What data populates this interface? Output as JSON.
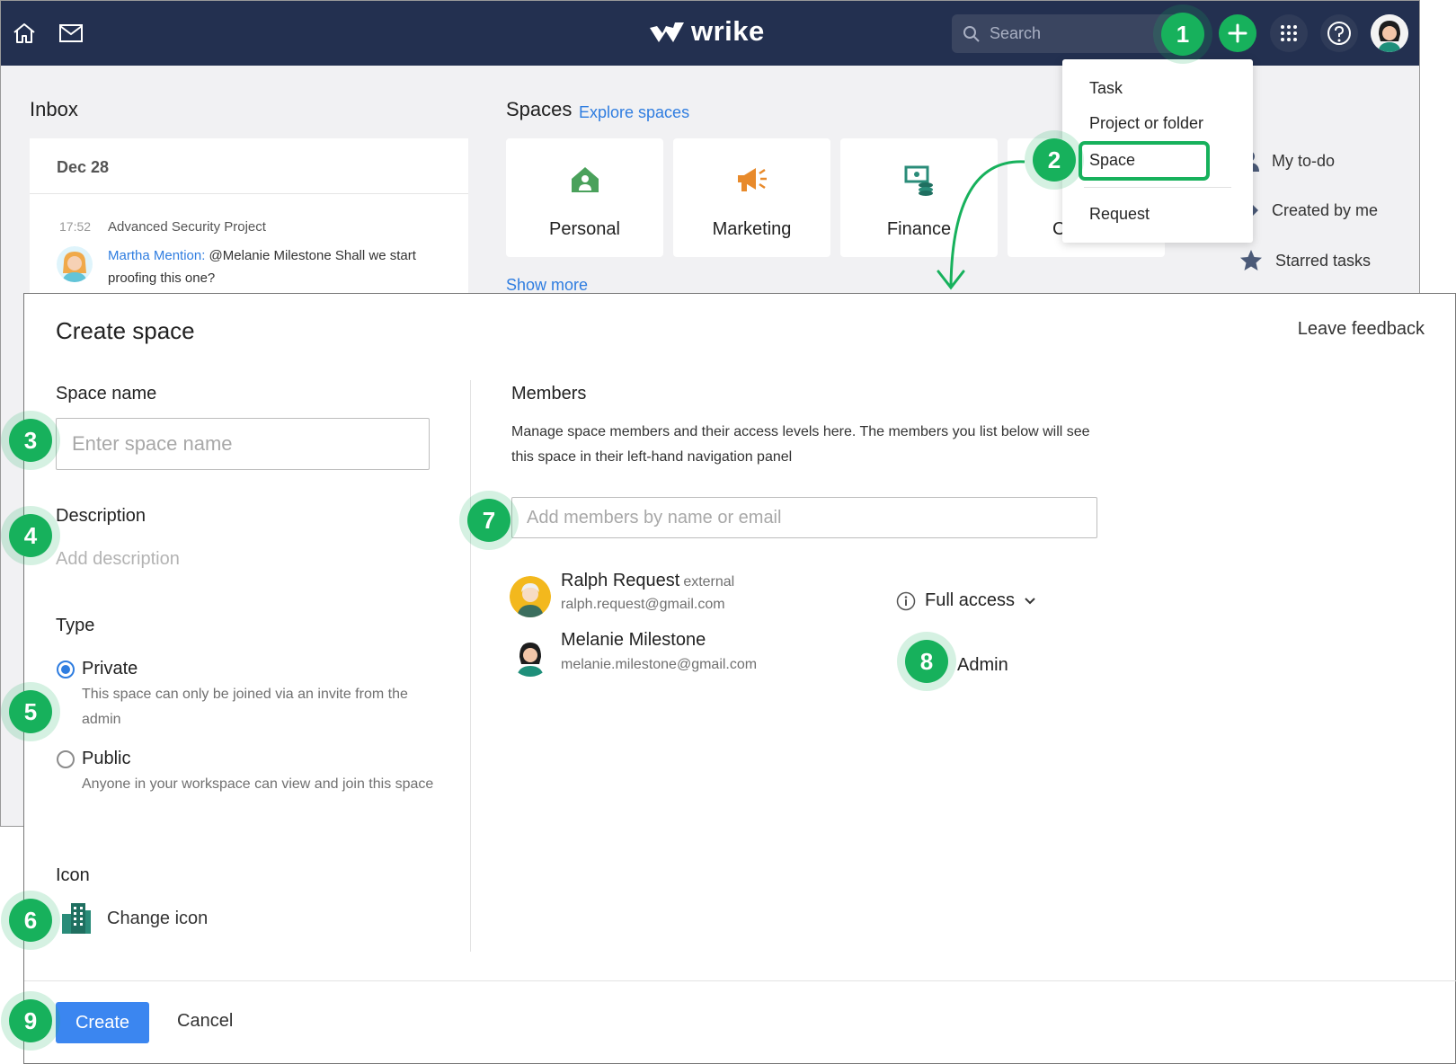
{
  "brand": {
    "name": "wrike",
    "accent": "#17b15c",
    "nav_bg": "#233050",
    "link": "#2f7de0",
    "primary_button": "#3b86f0"
  },
  "topbar": {
    "search_placeholder": "Search",
    "icons": [
      "home-icon",
      "mail-icon",
      "search-icon",
      "plus-icon",
      "apps-grid-icon",
      "help-icon"
    ]
  },
  "inbox": {
    "title": "Inbox",
    "date": "Dec 28",
    "notification": {
      "time": "17:52",
      "project": "Advanced Security Project",
      "author": "Martha Mention:",
      "message": " @Melanie Milestone Shall we start proofing this one?"
    }
  },
  "spaces": {
    "title": "Spaces",
    "explore": "Explore spaces",
    "cards": [
      "Personal",
      "Marketing",
      "Finance",
      "C"
    ],
    "show_more": "Show more"
  },
  "sidebar_links": [
    "My to-do",
    "Created by me",
    "Starred tasks"
  ],
  "new_menu": {
    "items": [
      "Task",
      "Project or folder",
      "Space",
      "Request"
    ]
  },
  "markers": [
    "1",
    "2",
    "3",
    "4",
    "5",
    "6",
    "7",
    "8",
    "9"
  ],
  "modal": {
    "title": "Create space",
    "feedback": "Leave feedback",
    "space_name": {
      "label": "Space name",
      "placeholder": "Enter space name"
    },
    "description": {
      "label": "Description",
      "placeholder": "Add description"
    },
    "type": {
      "label": "Type",
      "options": [
        {
          "label": "Private",
          "desc": "This space can only be joined via an invite from the admin",
          "selected": true
        },
        {
          "label": "Public",
          "desc": "Anyone in your workspace can view and join this space",
          "selected": false
        }
      ]
    },
    "icon": {
      "label": "Icon",
      "action": "Change icon"
    },
    "members": {
      "title": "Members",
      "desc": "Manage space members and their access levels here. The members you list below will see this space in their left-hand navigation panel",
      "placeholder": "Add members by name or email",
      "list": [
        {
          "name": "Ralph Request",
          "tag": "external",
          "email": "ralph.request@gmail.com",
          "access": "Full access"
        },
        {
          "name": "Melanie Milestone",
          "tag": "",
          "email": "melanie.milestone@gmail.com",
          "access": "Admin"
        }
      ]
    },
    "buttons": {
      "create": "Create",
      "cancel": "Cancel"
    }
  }
}
